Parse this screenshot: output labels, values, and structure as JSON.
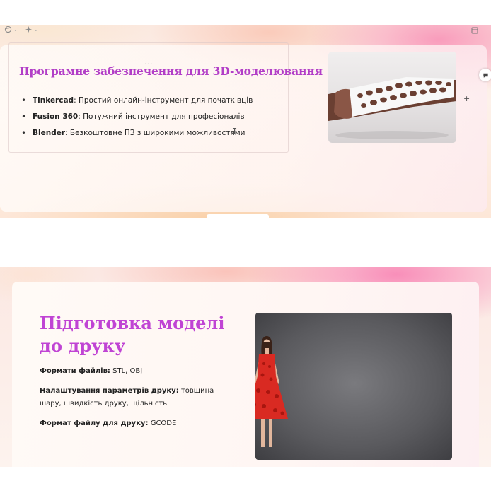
{
  "slide1": {
    "title": "Програмне забезпечення для 3D-моделювання",
    "items": [
      {
        "term": "Tinkercad",
        "desc": ": Простий онлайн-інструмент для початківців"
      },
      {
        "term": "Fusion 360",
        "desc": ": Потужний інструмент для професіоналів"
      },
      {
        "term": "Blender",
        "desc": ": Безкоштовне ПЗ з широкими можливостями"
      }
    ],
    "image": "3d-printed-lattice-cast-on-arm",
    "icons": [
      "theme-palette-icon",
      "ai-sparkle-icon",
      "layout-icon",
      "comment-icon",
      "plus-icon",
      "drag-handle-icon",
      "more-dots-icon",
      "text-cursor-icon"
    ]
  },
  "slide2": {
    "title": "Підготовка моделі до друку",
    "paragraphs": [
      {
        "label": "Формати файлів:",
        "text": " STL, OBJ"
      },
      {
        "label": "Налаштування параметрів друку:",
        "text": " товщина шару, швидкість друку, щільність"
      },
      {
        "label": "Формат файлу для друку:",
        "text": " GCODE"
      }
    ],
    "image": "three-models-in-red-3d-printed-dress"
  },
  "colors": {
    "title_purple": "#b23ec7",
    "title_magenta": "#c044d4",
    "accent_pink": "#f882af"
  }
}
